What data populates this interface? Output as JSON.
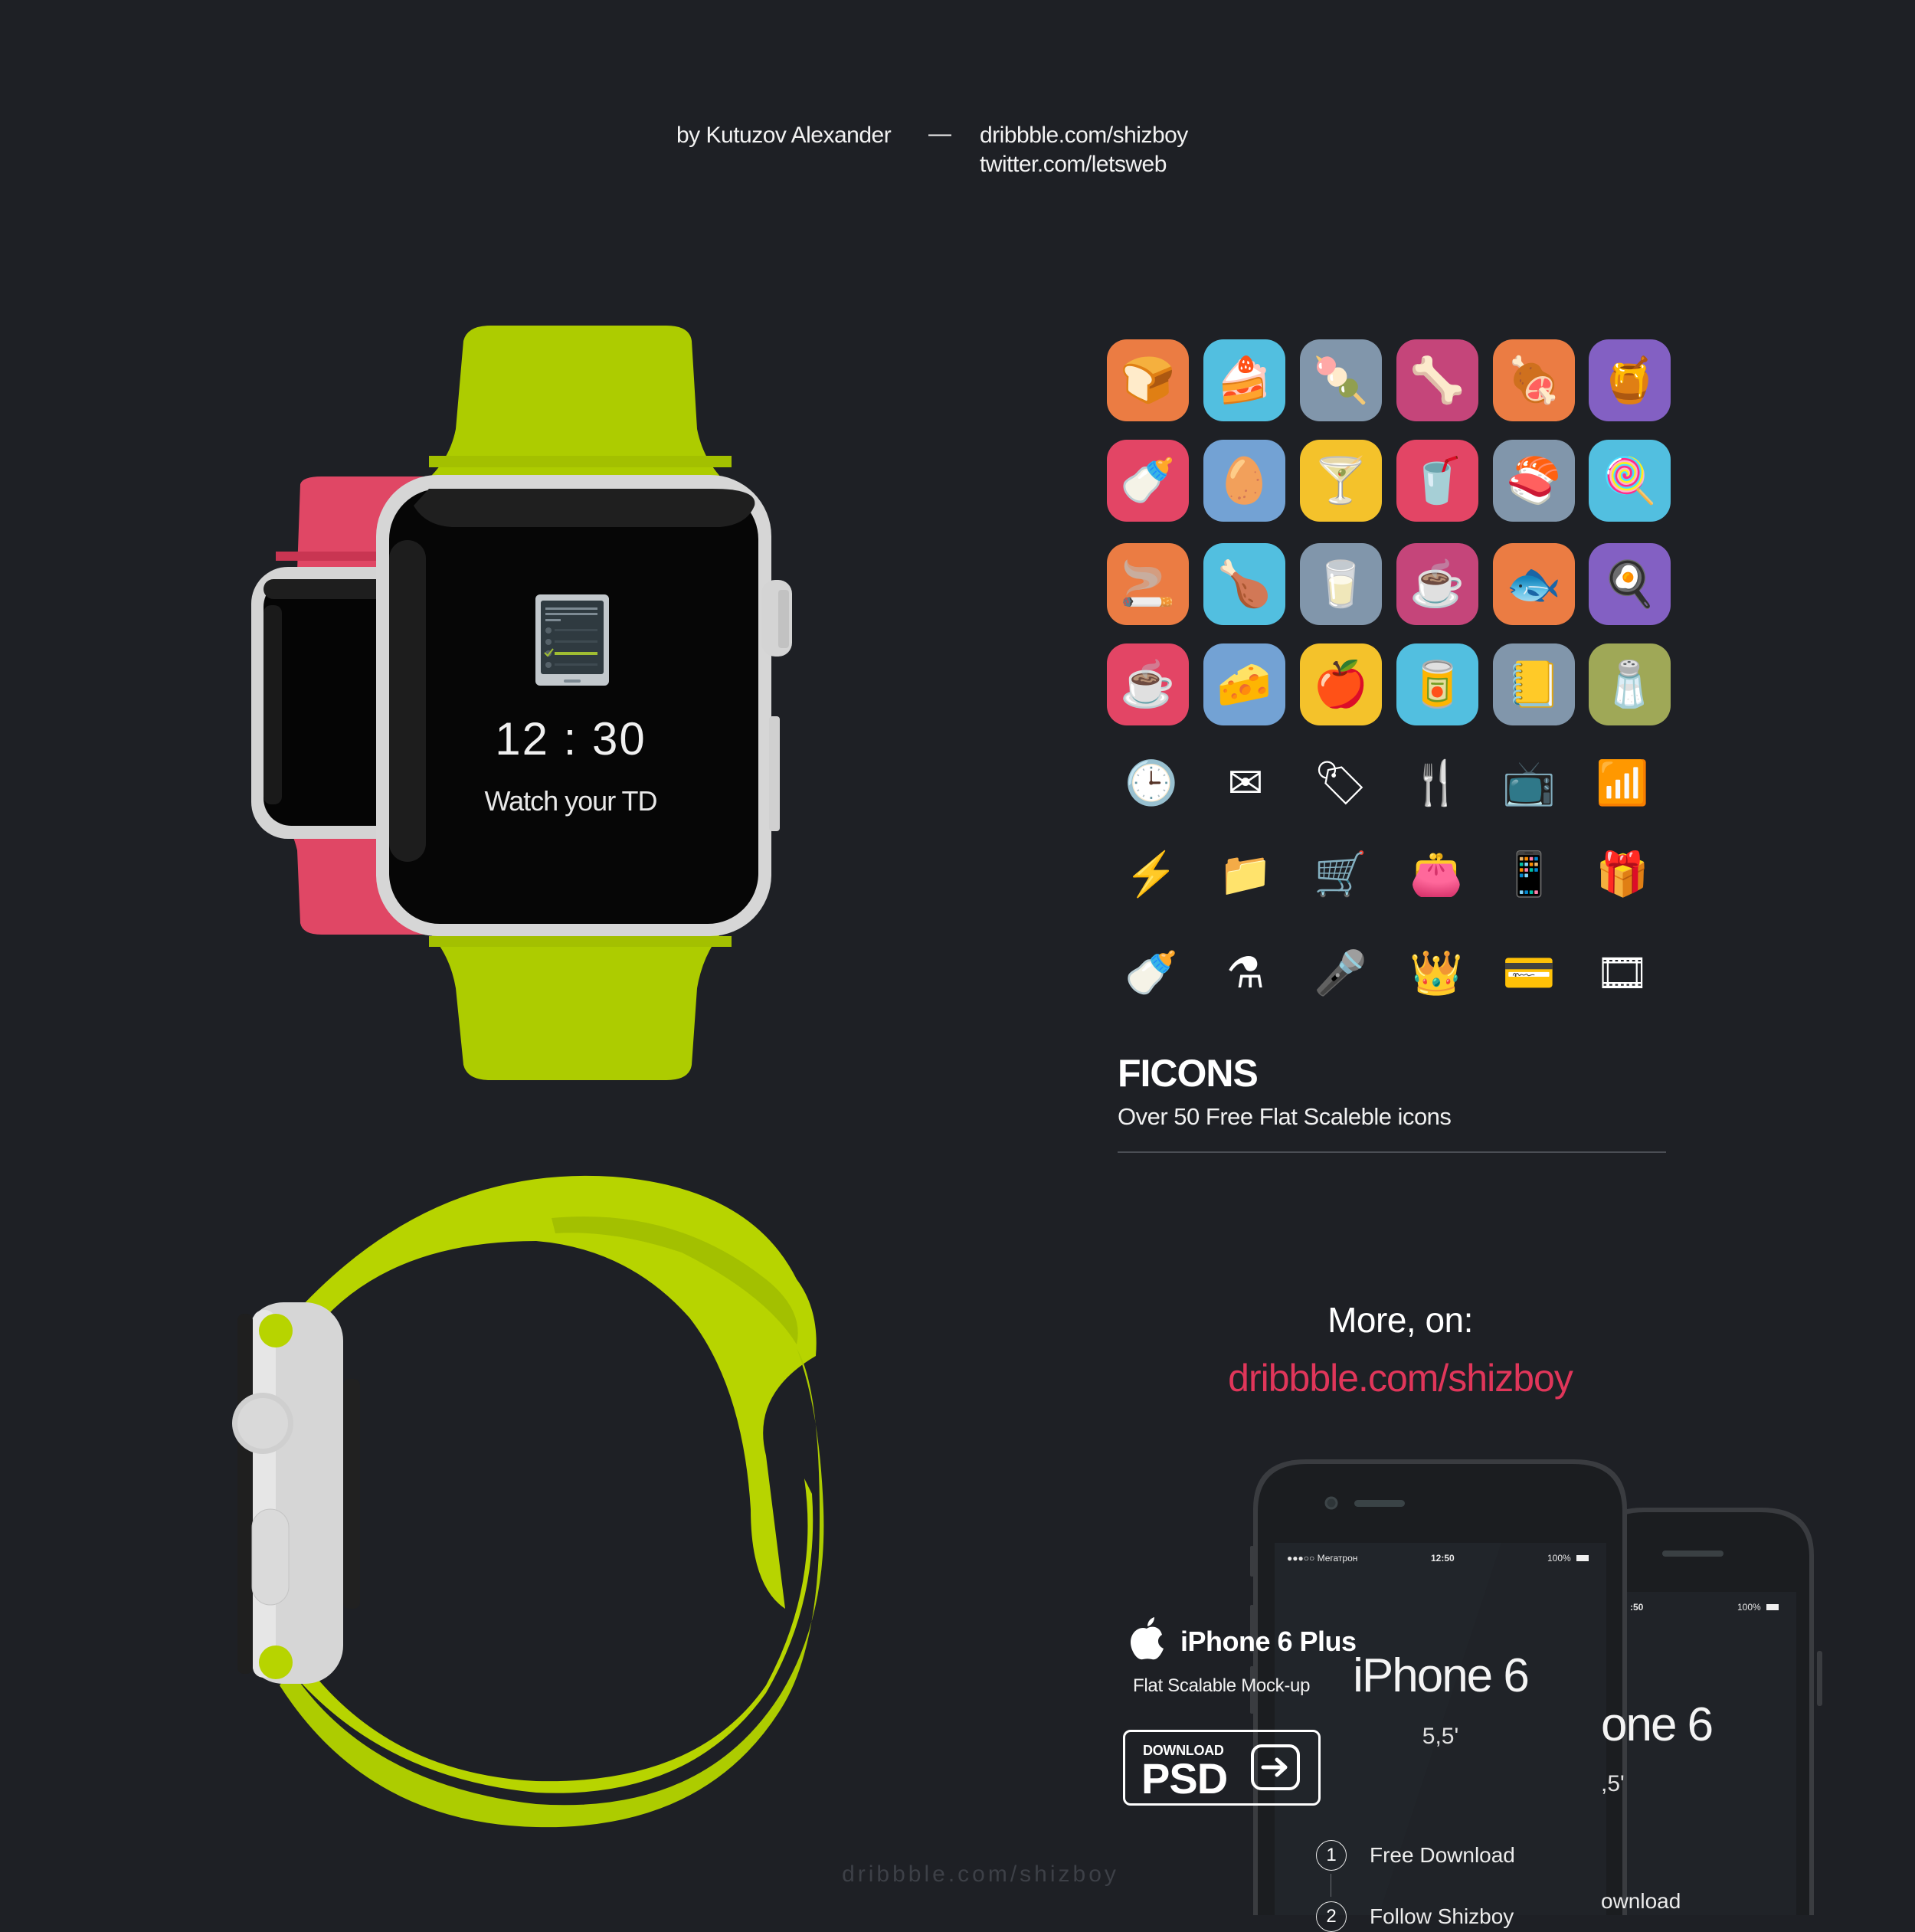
{
  "header": {
    "author": "by Kutuzov Alexander",
    "separator": "—",
    "links": [
      "dribbble.com/shizboy",
      "twitter.com/letsweb"
    ]
  },
  "watch": {
    "time": "12 : 30",
    "caption": "Watch your TD",
    "app_icon": "todo-list-icon",
    "band_colors": {
      "front": "#adcc00",
      "back": "#e04765",
      "side": "#b7d400"
    },
    "case_color": "#d4d4d4"
  },
  "ficons": {
    "tiles": [
      {
        "icon": "bread-icon",
        "glyph": "🍞",
        "color": "#eb7c43"
      },
      {
        "icon": "cake-icon",
        "glyph": "🍰",
        "color": "#52bfe0"
      },
      {
        "icon": "popsicle-icon",
        "glyph": "🍡",
        "color": "#8196ab"
      },
      {
        "icon": "bone-icon",
        "glyph": "🦴",
        "color": "#c5457a"
      },
      {
        "icon": "meat-icon",
        "glyph": "🍖",
        "color": "#eb7c43"
      },
      {
        "icon": "jar-icon",
        "glyph": "🍯",
        "color": "#8360c3"
      },
      {
        "icon": "bottle-icon",
        "glyph": "🍼",
        "color": "#e34565"
      },
      {
        "icon": "egg-icon",
        "glyph": "🥚",
        "color": "#73a2d4"
      },
      {
        "icon": "cocktail-icon",
        "glyph": "🍸",
        "color": "#f4c22b"
      },
      {
        "icon": "juice-icon",
        "glyph": "🥤",
        "color": "#e34565"
      },
      {
        "icon": "sushi-icon",
        "glyph": "🍣",
        "color": "#8196ab"
      },
      {
        "icon": "candy-icon",
        "glyph": "🍭",
        "color": "#52bfe0"
      },
      {
        "icon": "cigarettes-icon",
        "glyph": "🚬",
        "color": "#eb7c43"
      },
      {
        "icon": "chicken-leg-icon",
        "glyph": "🍗",
        "color": "#52bfe0"
      },
      {
        "icon": "milk-icon",
        "glyph": "🥛",
        "color": "#8196ab"
      },
      {
        "icon": "tea-cup-icon",
        "glyph": "☕",
        "color": "#c5457a"
      },
      {
        "icon": "fish-icon",
        "glyph": "🐟",
        "color": "#eb7c43"
      },
      {
        "icon": "fried-egg-icon",
        "glyph": "🍳",
        "color": "#8360c3"
      },
      {
        "icon": "coffee-cup-icon",
        "glyph": "☕",
        "color": "#e34565"
      },
      {
        "icon": "cheese-icon",
        "glyph": "🧀",
        "color": "#73a2d4"
      },
      {
        "icon": "apple-fruit-icon",
        "glyph": "🍎",
        "color": "#f4c22b"
      },
      {
        "icon": "soda-can-icon",
        "glyph": "🥫",
        "color": "#52bfe0"
      },
      {
        "icon": "book-icon",
        "glyph": "📒",
        "color": "#8196ab"
      },
      {
        "icon": "salt-icon",
        "glyph": "🧂",
        "color": "#9fa857"
      }
    ],
    "icons": [
      {
        "icon": "clock-icon",
        "glyph": "🕒"
      },
      {
        "icon": "mail-icon",
        "glyph": "✉"
      },
      {
        "icon": "tag-icon",
        "glyph": "🏷"
      },
      {
        "icon": "cutlery-icon",
        "glyph": "🍴"
      },
      {
        "icon": "tv-icon",
        "glyph": "📺"
      },
      {
        "icon": "wifi-icon",
        "glyph": "📶"
      },
      {
        "icon": "lightning-icon",
        "glyph": "⚡"
      },
      {
        "icon": "folder-icon",
        "glyph": "📁"
      },
      {
        "icon": "cart-icon",
        "glyph": "🛒"
      },
      {
        "icon": "wallet-icon",
        "glyph": "👛"
      },
      {
        "icon": "phone-icon",
        "glyph": "📱"
      },
      {
        "icon": "gift-icon",
        "glyph": "🎁"
      },
      {
        "icon": "pacifier-icon",
        "glyph": "🍼"
      },
      {
        "icon": "hookah-icon",
        "glyph": "⚗"
      },
      {
        "icon": "microphone-icon",
        "glyph": "🎤"
      },
      {
        "icon": "vip-icon",
        "glyph": "👑"
      },
      {
        "icon": "credit-card-icon",
        "glyph": "💳"
      },
      {
        "icon": "film-icon",
        "glyph": "🎞"
      }
    ],
    "title": "FICONS",
    "subtitle": "Over 50 Free Flat Scaleble icons"
  },
  "more": {
    "label": "More, on:",
    "link": "dribbble.com/shizboy",
    "link_color": "#e0365a"
  },
  "iphone_promo": {
    "title": "iPhone 6 Plus",
    "subtitle": "Flat Scalable Mock-up",
    "button_small": "DOWNLOAD",
    "button_big": "PSD"
  },
  "phone_front": {
    "carrier": "●●●○○  Мегатрон",
    "time": "12:50",
    "battery": "100%",
    "title": "iPhone 6",
    "size": "5,5'",
    "steps": [
      {
        "num": "1",
        "label": "Free Download"
      },
      {
        "num": "2",
        "label": "Follow Shizboy"
      }
    ]
  },
  "phone_back": {
    "time": ":50",
    "battery": "100%",
    "title": "one 6",
    "size": ",5'",
    "step": "ownload"
  },
  "watermark": "dribbble.com/shizboy"
}
